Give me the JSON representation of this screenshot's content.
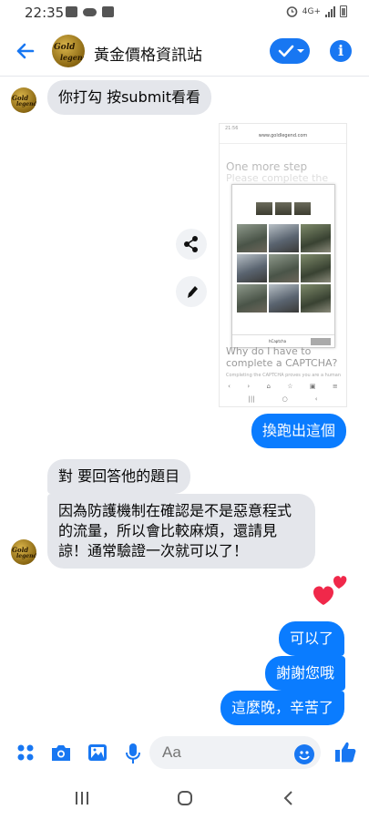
{
  "status_bar": {
    "time": "22:35",
    "network": "4G+"
  },
  "header": {
    "contact_name": "黃金價格資訊站",
    "avatar_text_1": "Gold",
    "avatar_text_2": "legend"
  },
  "messages": [
    {
      "id": "m1",
      "direction": "incoming",
      "text": "你打勾 按submit看看"
    },
    {
      "id": "m2",
      "direction": "outgoing",
      "type": "image"
    },
    {
      "id": "m3",
      "direction": "outgoing",
      "text": "換跑出這個"
    },
    {
      "id": "m4",
      "direction": "incoming",
      "text": "對 要回答他的題目"
    },
    {
      "id": "m5",
      "direction": "incoming",
      "lines": [
        "因為防護機制在確認是不是惡意程式",
        "的流量，所以會比較麻煩，還請見",
        "諒！通常驗證一次就可以了！"
      ]
    },
    {
      "id": "m6",
      "direction": "outgoing",
      "text": "可以了"
    },
    {
      "id": "m7",
      "direction": "outgoing",
      "text": "謝謝您哦"
    },
    {
      "id": "m8",
      "direction": "outgoing",
      "text": "這麼晚，辛苦了"
    }
  ],
  "screenshot": {
    "time": "21:56",
    "url": "www.goldlegend.com",
    "heading": "One more step",
    "subheading": "Please complete the",
    "captcha_brand": "hCaptcha",
    "why_text": "Why do I have to complete a CAPTCHA?",
    "small_text": "Completing the CAPTCHA proves you are a human"
  },
  "composer": {
    "placeholder": "Aa"
  },
  "colors": {
    "accent": "#1877f2",
    "outgoing_bubble": "#0a7cff",
    "incoming_bubble": "#e4e6eb",
    "heart": "#f0284a"
  }
}
